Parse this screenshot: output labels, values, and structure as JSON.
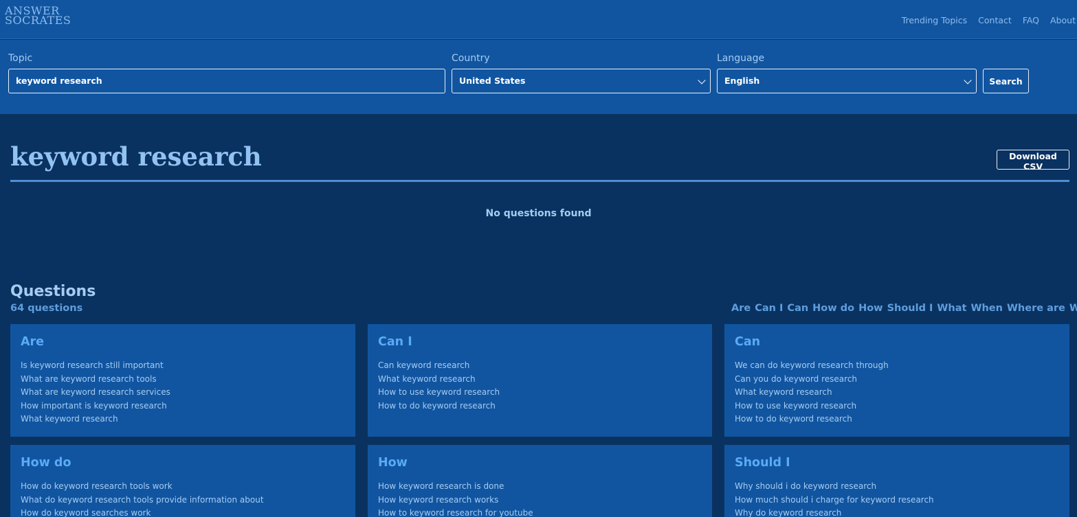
{
  "header": {
    "logo_line1": "ANSWER",
    "logo_line2": "SOCRATES",
    "nav": [
      "Trending Topics",
      "Contact",
      "FAQ",
      "About"
    ]
  },
  "search": {
    "topic_label": "Topic",
    "topic_value": "keyword research",
    "country_label": "Country",
    "country_value": "United States",
    "language_label": "Language",
    "language_value": "English",
    "search_button": "Search"
  },
  "main": {
    "title": "keyword research",
    "download_button": "Download CSV",
    "empty_message": "No questions found"
  },
  "questions": {
    "title": "Questions",
    "count": "64 questions",
    "filters": [
      "Are",
      "Can I",
      "Can",
      "How do",
      "How",
      "Should I",
      "What",
      "When",
      "Where are",
      "Where",
      "Wh"
    ]
  },
  "cards": [
    {
      "title": "Are",
      "items": [
        "Is keyword research still important",
        "What are keyword research tools",
        "What are keyword research services",
        "How important is keyword research",
        "What keyword research"
      ]
    },
    {
      "title": "Can I",
      "items": [
        "Can keyword research",
        "What keyword research",
        "How to use keyword research",
        "How to do keyword research"
      ]
    },
    {
      "title": "Can",
      "items": [
        "We can do keyword research through",
        "Can you do keyword research",
        "What keyword research",
        "How to use keyword research",
        "How to do keyword research"
      ]
    },
    {
      "title": "How do",
      "items": [
        "How do keyword research tools work",
        "What do keyword research tools provide information about",
        "How do keyword searches work"
      ]
    },
    {
      "title": "How",
      "items": [
        "How keyword research is done",
        "How keyword research works",
        "How to keyword research for youtube"
      ]
    },
    {
      "title": "Should I",
      "items": [
        "Why should i do keyword research",
        "How much should i charge for keyword research",
        "Why do keyword research"
      ]
    }
  ]
}
